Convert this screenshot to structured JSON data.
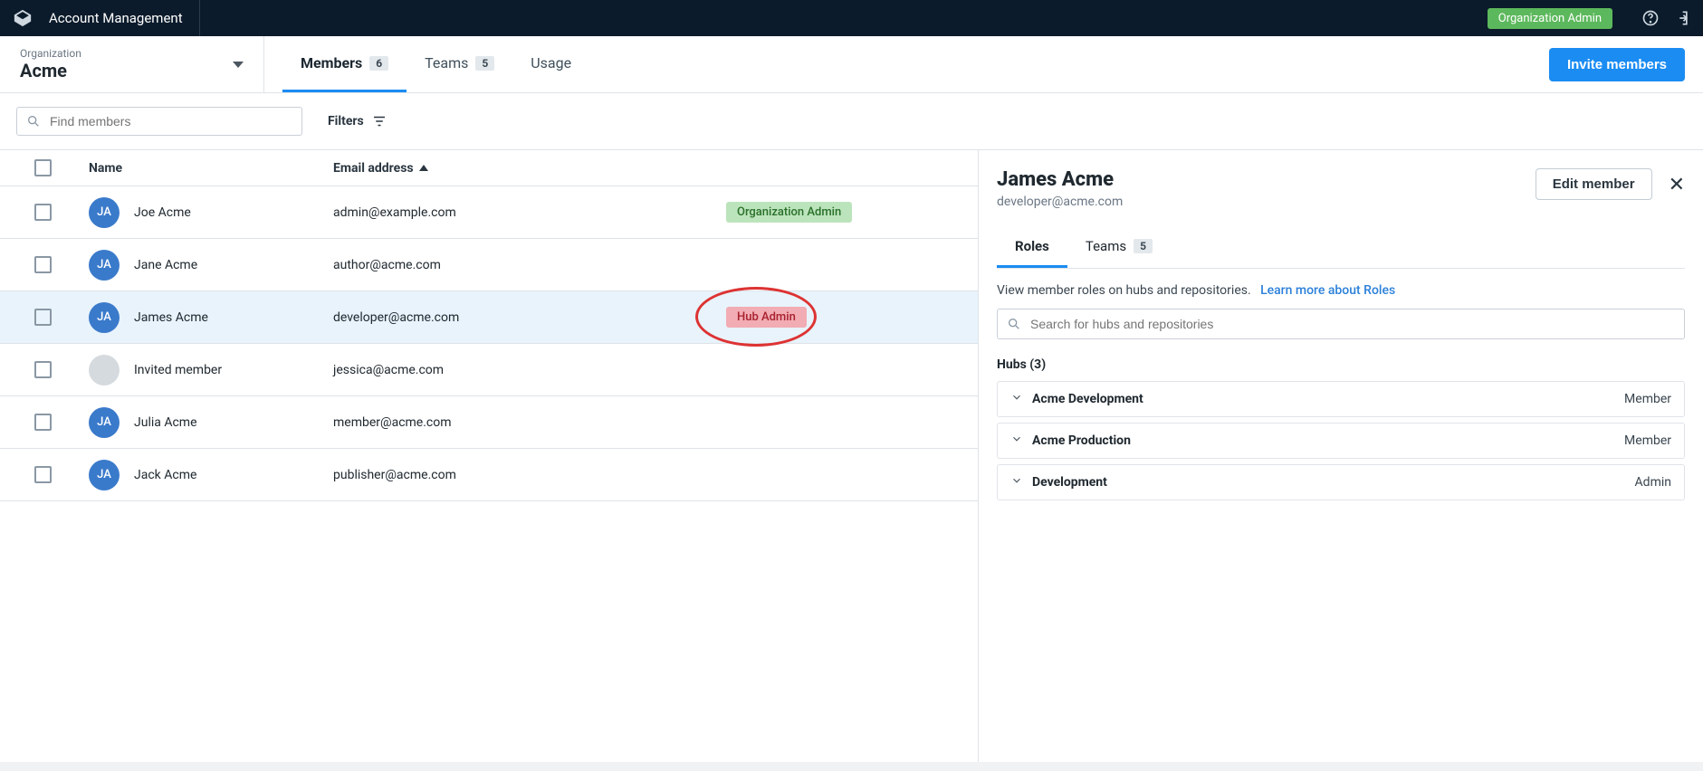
{
  "header": {
    "app_title": "Account Management",
    "org_admin_pill": "Organization Admin"
  },
  "org_selector": {
    "label": "Organization",
    "name": "Acme"
  },
  "tabs": {
    "members": {
      "label": "Members",
      "count": "6"
    },
    "teams": {
      "label": "Teams",
      "count": "5"
    },
    "usage": {
      "label": "Usage"
    },
    "invite_button": "Invite members"
  },
  "filters": {
    "search_placeholder": "Find members",
    "filters_label": "Filters"
  },
  "table": {
    "col_name": "Name",
    "col_email": "Email address",
    "rows": [
      {
        "initials": "JA",
        "name": "Joe Acme",
        "email": "admin@example.com",
        "role": "Organization Admin",
        "role_kind": "orgadmin"
      },
      {
        "initials": "JA",
        "name": "Jane Acme",
        "email": "author@acme.com"
      },
      {
        "initials": "JA",
        "name": "James Acme",
        "email": "developer@acme.com",
        "role": "Hub Admin",
        "role_kind": "hubadmin",
        "selected": true,
        "annot": true
      },
      {
        "name": "Invited member",
        "email": "jessica@acme.com",
        "blank": true
      },
      {
        "initials": "JA",
        "name": "Julia Acme",
        "email": "member@acme.com"
      },
      {
        "initials": "JA",
        "name": "Jack Acme",
        "email": "publisher@acme.com"
      }
    ]
  },
  "detail": {
    "name": "James Acme",
    "email": "developer@acme.com",
    "edit_button": "Edit member",
    "tab_roles": "Roles",
    "tab_teams": "Teams",
    "tab_teams_count": "5",
    "info_text": "View member roles on hubs and repositories.",
    "learn_more": "Learn more about Roles",
    "search_placeholder": "Search for hubs and repositories",
    "hubs_title": "Hubs (3)",
    "hubs": [
      {
        "name": "Acme Development",
        "role": "Member"
      },
      {
        "name": "Acme Production",
        "role": "Member"
      },
      {
        "name": "Development",
        "role": "Admin"
      }
    ]
  }
}
